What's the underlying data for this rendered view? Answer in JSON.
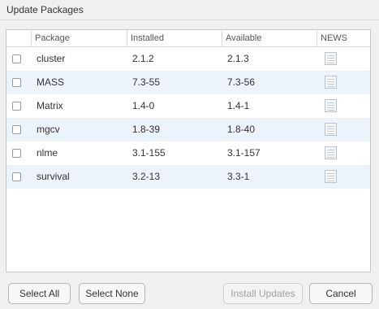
{
  "window": {
    "title": "Update Packages"
  },
  "table": {
    "columns": {
      "select": "",
      "package": "Package",
      "installed": "Installed",
      "available": "Available",
      "news": "NEWS"
    },
    "rows": [
      {
        "package": "cluster",
        "installed": "2.1.2",
        "available": "2.1.3",
        "checked": false
      },
      {
        "package": "MASS",
        "installed": "7.3-55",
        "available": "7.3-56",
        "checked": false
      },
      {
        "package": "Matrix",
        "installed": "1.4-0",
        "available": "1.4-1",
        "checked": false
      },
      {
        "package": "mgcv",
        "installed": "1.8-39",
        "available": "1.8-40",
        "checked": false
      },
      {
        "package": "nlme",
        "installed": "3.1-155",
        "available": "3.1-157",
        "checked": false
      },
      {
        "package": "survival",
        "installed": "3.2-13",
        "available": "3.3-1",
        "checked": false
      }
    ]
  },
  "buttons": {
    "select_all": "Select All",
    "select_none": "Select None",
    "install_updates": "Install Updates",
    "cancel": "Cancel"
  },
  "icons": {
    "news": "document-icon"
  },
  "colors": {
    "row_alt": "#edf3fb",
    "background": "#f0f0f0"
  }
}
